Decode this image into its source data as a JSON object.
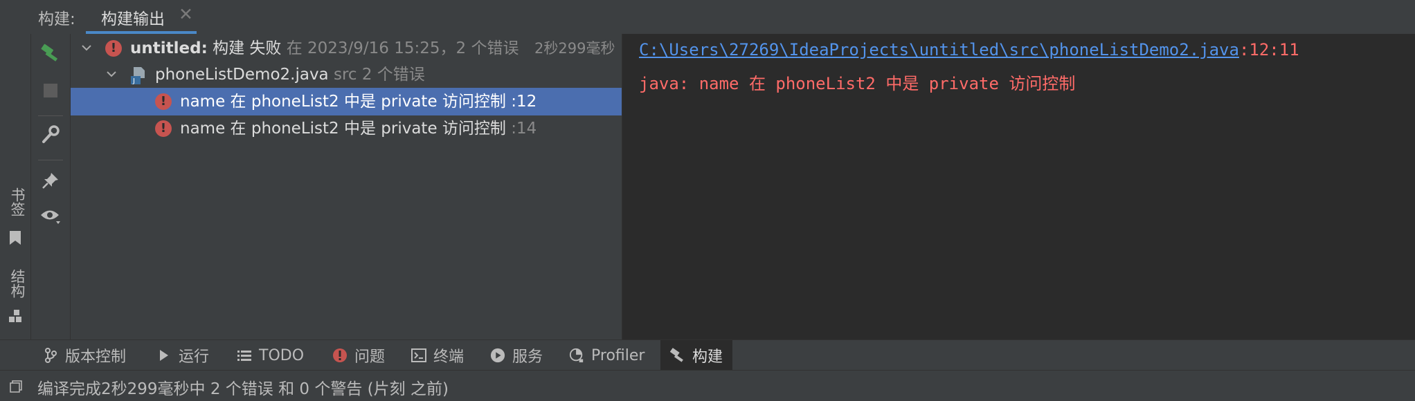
{
  "header": {
    "title": "构建:",
    "tab_label": "构建输出",
    "tab_close": "✕"
  },
  "left_stripe": {
    "bookmarks_label": "书签",
    "structure_label": "结构"
  },
  "tree": {
    "root": {
      "name": "untitled:",
      "status": "构建 失败",
      "detail": "在 2023/9/16 15:25，2 个错误",
      "duration": "2秒299毫秒"
    },
    "file": {
      "name": "phoneListDemo2.java",
      "detail": "src 2 个错误"
    },
    "errors": [
      {
        "message": "name 在 phoneList2 中是 private 访问控制",
        "line": ":12",
        "selected": true
      },
      {
        "message": "name 在 phoneList2 中是 private 访问控制",
        "line": ":14",
        "selected": false
      }
    ]
  },
  "console": {
    "path": "C:\\Users\\27269\\IdeaProjects\\untitled\\src\\phoneListDemo2.java",
    "location": ":12:11",
    "message": "java: name 在 phoneList2 中是 private 访问控制"
  },
  "bottom_tabs": [
    {
      "label": "版本控制",
      "icon": "branch-icon"
    },
    {
      "label": "运行",
      "icon": "run-icon"
    },
    {
      "label": "TODO",
      "icon": "list-icon"
    },
    {
      "label": "问题",
      "icon": "problem-icon"
    },
    {
      "label": "终端",
      "icon": "terminal-icon"
    },
    {
      "label": "服务",
      "icon": "services-icon"
    },
    {
      "label": "Profiler",
      "icon": "profiler-icon"
    },
    {
      "label": "构建",
      "icon": "hammer-icon",
      "active": true
    }
  ],
  "status_bar": {
    "message": "编译完成2秒299毫秒中 2 个错误 和 0 个警告 (片刻 之前)"
  },
  "colors": {
    "accent": "#4a88c7",
    "selection": "#4b6eaf",
    "error": "#c75450",
    "link": "#5394ec",
    "console_error": "#ff6b68",
    "build_green": "#499c54"
  }
}
